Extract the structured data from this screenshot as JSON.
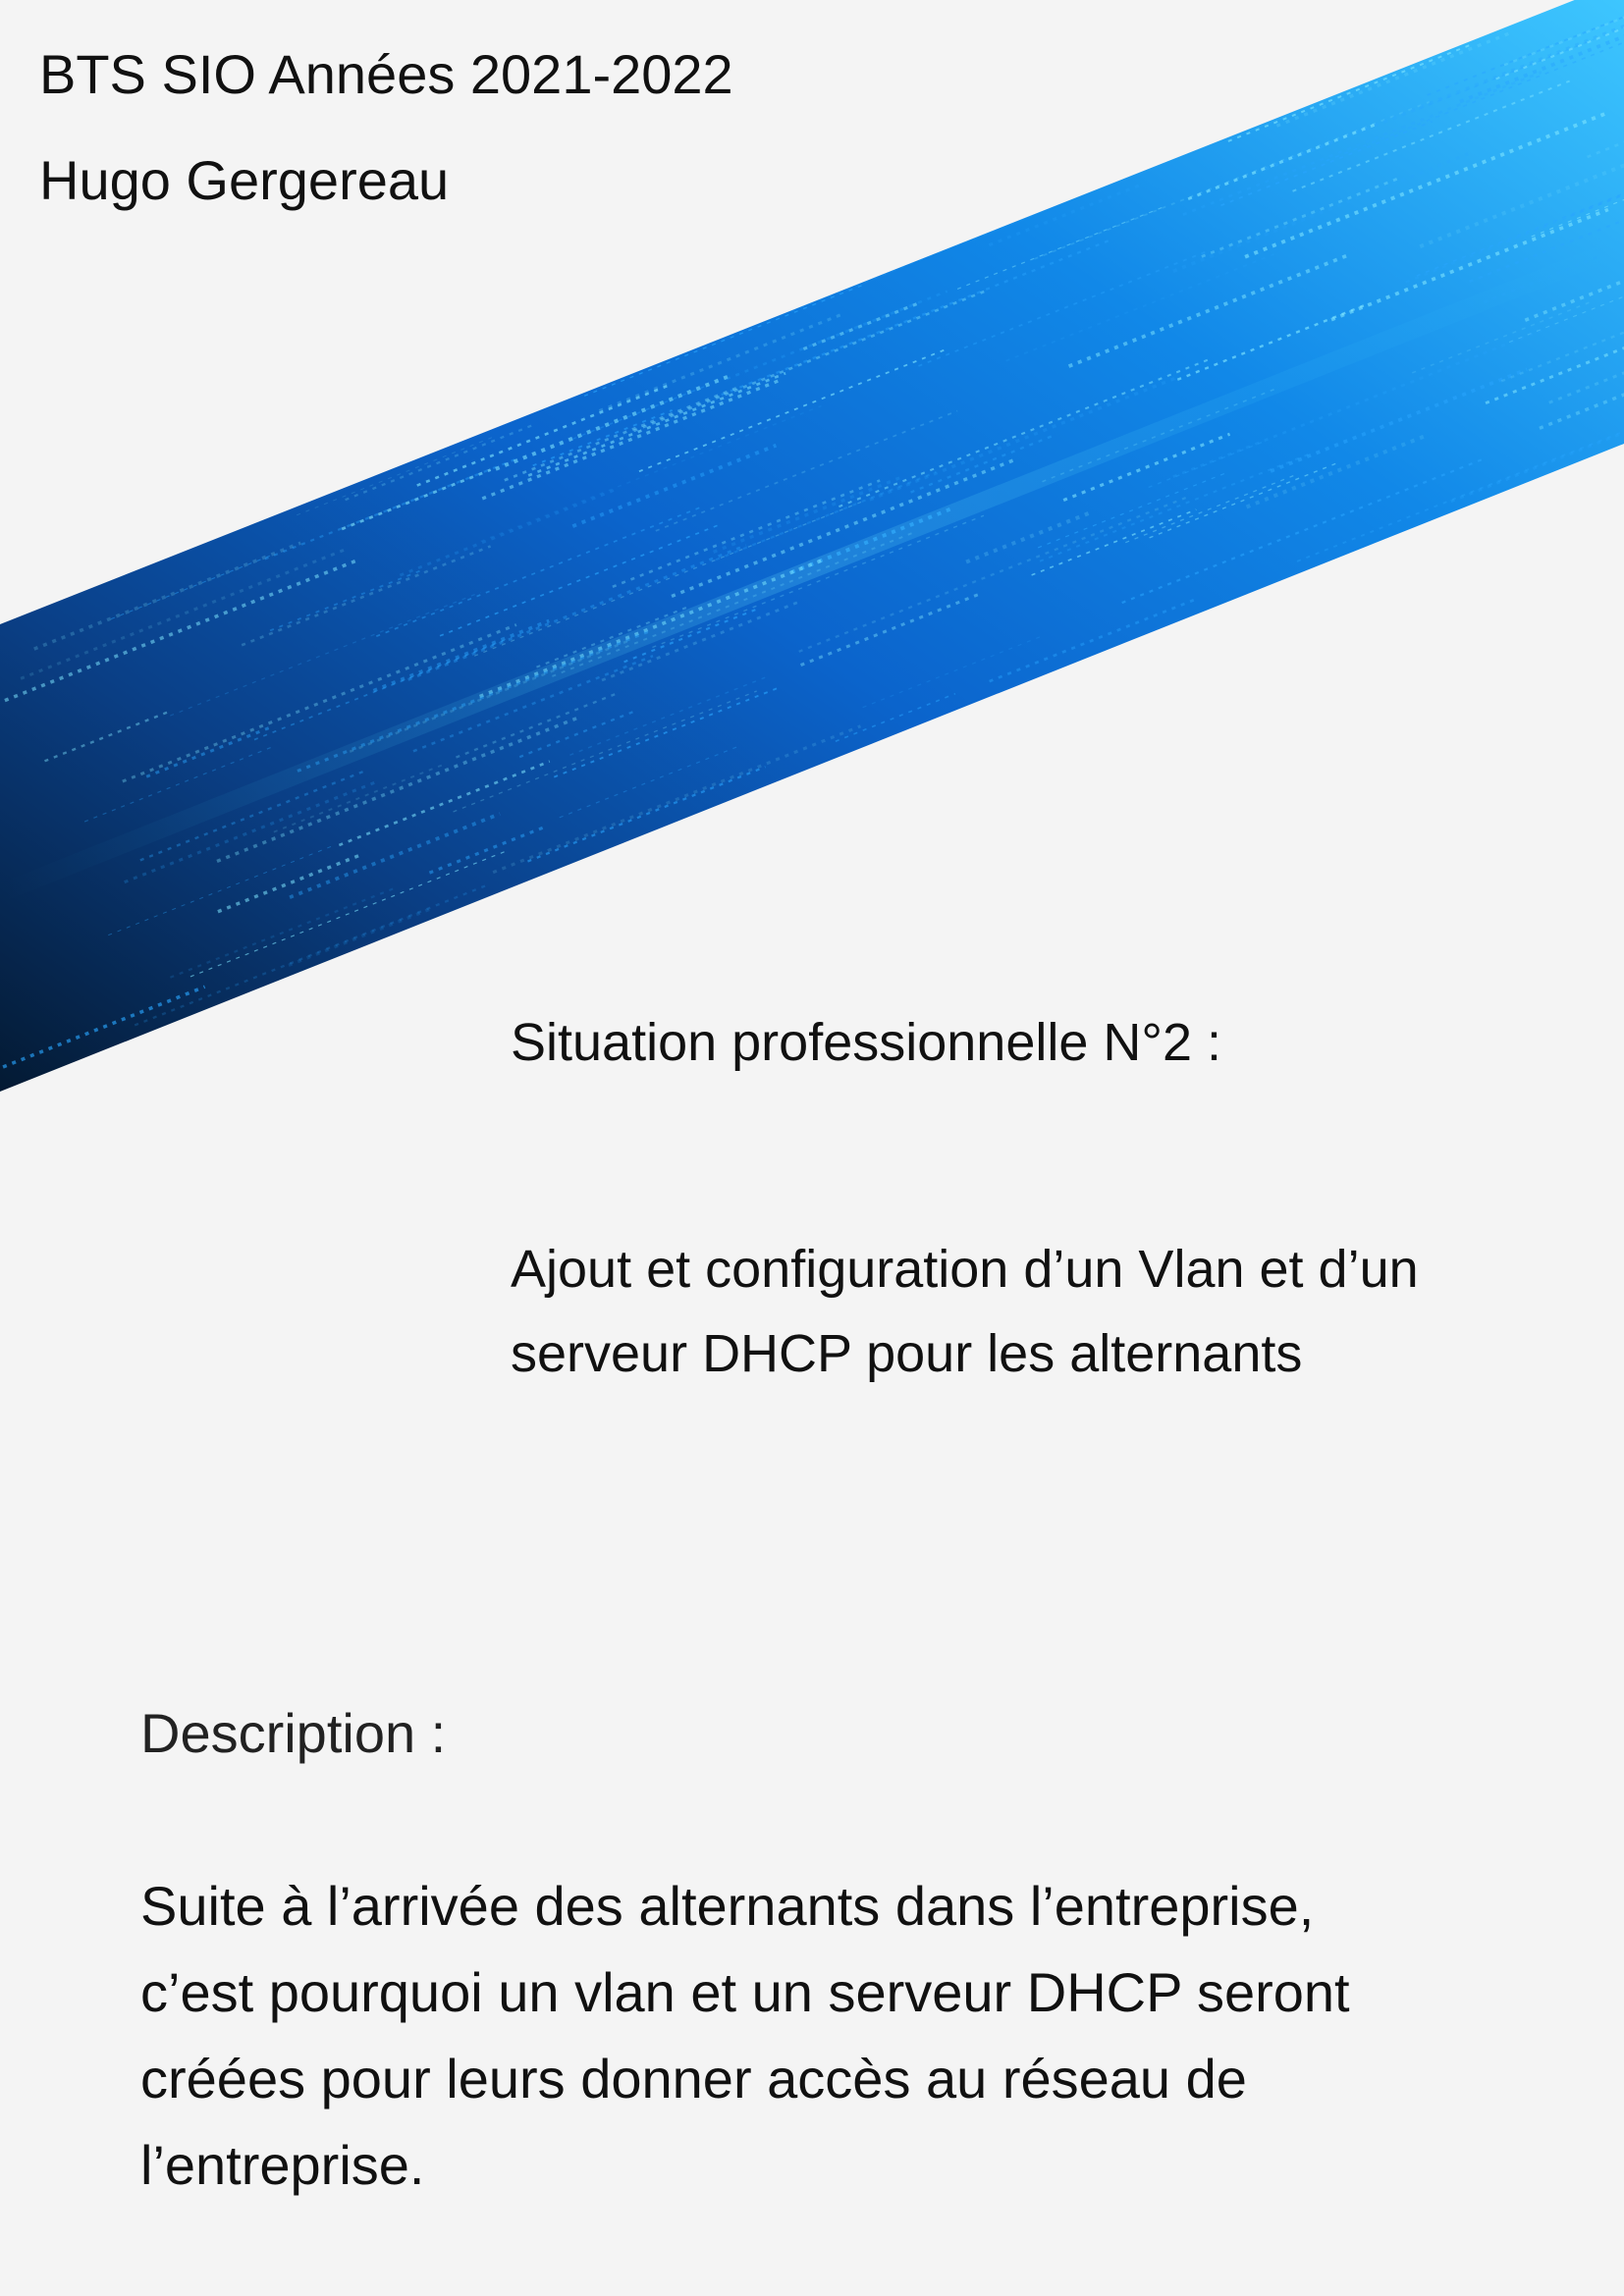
{
  "header": {
    "year_line": "BTS SIO Années 2021-2022",
    "author": "Hugo Gergereau"
  },
  "banner": {
    "image": "binary-code-blue-diagonal-stripe",
    "colors": {
      "dark": "#05213f",
      "mid": "#0a63c9",
      "bright": "#35d4ff"
    }
  },
  "situation": {
    "label": "Situation professionnelle N°2 :"
  },
  "title": {
    "lines": [
      "Ajout et configuration d’un Vlan et d’un",
      "serveur DHCP pour les alternants"
    ]
  },
  "description": {
    "label": "Description :",
    "lines": [
      "Suite à l’arrivée des alternants dans l’entreprise,",
      "c’est pourquoi un vlan et un serveur DHCP seront",
      "créées pour leurs donner accès au réseau de",
      "l’entreprise."
    ]
  }
}
